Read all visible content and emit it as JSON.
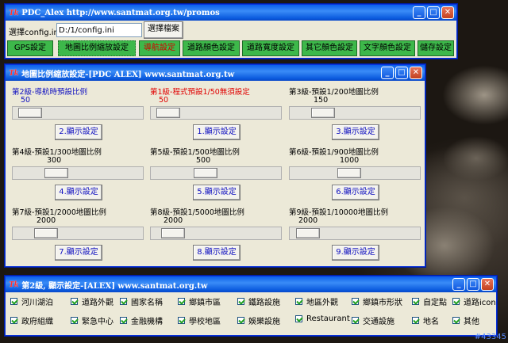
{
  "main_window": {
    "logo": "Tk",
    "title": "PDC_Alex http://www.santmat.org.tw/promos",
    "config_label": "選擇config.ini",
    "config_value": "D:/1/config.ini",
    "select_file": "選擇檔案",
    "toolbar": [
      "GPS設定",
      "地圖比例縮放設定",
      "導航設定",
      "道路顏色設定",
      "道路寬度設定",
      "其它顏色設定",
      "文字顏色設定",
      "儲存設定"
    ]
  },
  "scale_window": {
    "logo": "Tk",
    "title": "地圖比例縮放設定-[PDC ALEX] www.santmat.org.tw",
    "panels": [
      {
        "label": "第2級-導航時預設比例",
        "value": "50",
        "button": "2.顯示設定",
        "color": "#1010c0",
        "thumb": 0.05
      },
      {
        "label": "第1級-程式預設1/50無須設定",
        "value": "50",
        "button": "1.顯示設定",
        "color": "#e00000",
        "thumb": 0.05
      },
      {
        "label": "第3級-預設1/200地圖比例",
        "value": "150",
        "button": "3.顯示設定",
        "color": "#000000",
        "thumb": 0.2
      },
      {
        "label": "第4級-預設1/300地圖比例",
        "value": "300",
        "button": "4.顯示設定",
        "color": "#000000",
        "thumb": 0.3
      },
      {
        "label": "第5級-預設1/500地圖比例",
        "value": "500",
        "button": "5.顯示設定",
        "color": "#000000",
        "thumb": 0.4
      },
      {
        "label": "第6級-預設1/900地圖比例",
        "value": "1000",
        "button": "6.顯示設定",
        "color": "#000000",
        "thumb": 0.45
      },
      {
        "label": "第7級-預設1/2000地圖比例",
        "value": "2000",
        "button": "7.顯示設定",
        "color": "#000000",
        "thumb": 0.2
      },
      {
        "label": "第8級-預設1/5000地圖比例",
        "value": "2000",
        "button": "8.顯示設定",
        "color": "#000000",
        "thumb": 0.1
      },
      {
        "label": "第9級-預設1/10000地圖比例",
        "value": "2000",
        "button": "9.顯示設定",
        "color": "#000000",
        "thumb": 0.06
      }
    ]
  },
  "display_window": {
    "logo": "Tk",
    "title": "第2級, 顯示設定-[ALEX] www.santmat.org.tw",
    "row1": [
      "河川湖泊",
      "道路外觀",
      "國家名稱",
      "鄉鎮市區",
      "鐵路設施",
      "地區外觀",
      "鄉鎮市形狀",
      "自定點",
      "道路icon"
    ],
    "row2": [
      "政府組織",
      "緊急中心",
      "金融機構",
      "學校地區",
      "娛樂設施",
      "Restaurant",
      "交通設施",
      "地名",
      "其他"
    ]
  },
  "corner_text": "#43345"
}
